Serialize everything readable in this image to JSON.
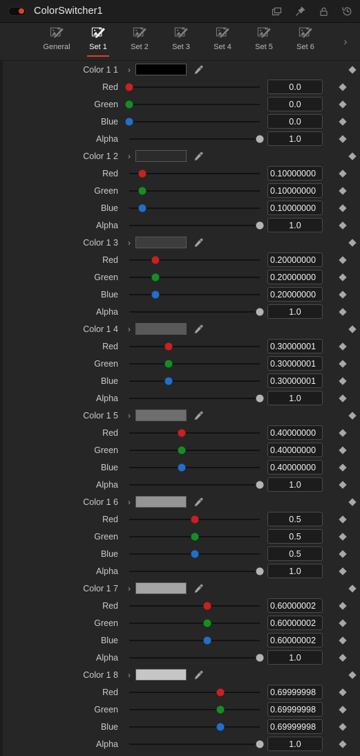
{
  "titlebar": {
    "node_name": "ColorSwitcher1",
    "enabled": true,
    "accent_red": "#e0402b",
    "icons": [
      {
        "name": "duplicate-icon",
        "label": "Duplicate"
      },
      {
        "name": "pin-icon",
        "label": "Pin"
      },
      {
        "name": "unlock-icon",
        "label": "Lock"
      },
      {
        "name": "reset-icon",
        "label": "Reset"
      }
    ]
  },
  "tabs": {
    "active": "Set 1",
    "items": [
      {
        "label": "General",
        "icon": "magic-wand-image-icon"
      },
      {
        "label": "Set 1",
        "icon": "magic-wand-image-icon"
      },
      {
        "label": "Set 2",
        "icon": "magic-wand-image-icon"
      },
      {
        "label": "Set 3",
        "icon": "magic-wand-image-icon"
      },
      {
        "label": "Set 4",
        "icon": "magic-wand-image-icon"
      },
      {
        "label": "Set 5",
        "icon": "magic-wand-image-icon"
      },
      {
        "label": "Set 6",
        "icon": "magic-wand-image-icon"
      }
    ],
    "overflow_label": "›"
  },
  "channel_labels": {
    "red": "Red",
    "green": "Green",
    "blue": "Blue",
    "alpha": "Alpha"
  },
  "expander_glyph": "›",
  "colors": [
    {
      "label": "Color 1 1",
      "swatch": "#000000",
      "red": {
        "value": "0.0",
        "pos": 0.0
      },
      "green": {
        "value": "0.0",
        "pos": 0.0
      },
      "blue": {
        "value": "0.0",
        "pos": 0.0
      },
      "alpha": {
        "value": "1.0",
        "pos": 1.0
      }
    },
    {
      "label": "Color 1 2",
      "swatch": "#2b2b2b",
      "red": {
        "value": "0.10000000",
        "pos": 0.1
      },
      "green": {
        "value": "0.10000000",
        "pos": 0.1
      },
      "blue": {
        "value": "0.10000000",
        "pos": 0.1
      },
      "alpha": {
        "value": "1.0",
        "pos": 1.0
      }
    },
    {
      "label": "Color 1 3",
      "swatch": "#3d3d3d",
      "red": {
        "value": "0.20000000",
        "pos": 0.2
      },
      "green": {
        "value": "0.20000000",
        "pos": 0.2
      },
      "blue": {
        "value": "0.20000000",
        "pos": 0.2
      },
      "alpha": {
        "value": "1.0",
        "pos": 1.0
      }
    },
    {
      "label": "Color 1 4",
      "swatch": "#585858",
      "red": {
        "value": "0.30000001",
        "pos": 0.3
      },
      "green": {
        "value": "0.30000001",
        "pos": 0.3
      },
      "blue": {
        "value": "0.30000001",
        "pos": 0.3
      },
      "alpha": {
        "value": "1.0",
        "pos": 1.0
      }
    },
    {
      "label": "Color 1 5",
      "swatch": "#6e6e6e",
      "red": {
        "value": "0.40000000",
        "pos": 0.4
      },
      "green": {
        "value": "0.40000000",
        "pos": 0.4
      },
      "blue": {
        "value": "0.40000000",
        "pos": 0.4
      },
      "alpha": {
        "value": "1.0",
        "pos": 1.0
      }
    },
    {
      "label": "Color 1 6",
      "swatch": "#949494",
      "red": {
        "value": "0.5",
        "pos": 0.5
      },
      "green": {
        "value": "0.5",
        "pos": 0.5
      },
      "blue": {
        "value": "0.5",
        "pos": 0.5
      },
      "alpha": {
        "value": "1.0",
        "pos": 1.0
      }
    },
    {
      "label": "Color 1 7",
      "swatch": "#a5a5a5",
      "red": {
        "value": "0.60000002",
        "pos": 0.6
      },
      "green": {
        "value": "0.60000002",
        "pos": 0.6
      },
      "blue": {
        "value": "0.60000002",
        "pos": 0.6
      },
      "alpha": {
        "value": "1.0",
        "pos": 1.0
      }
    },
    {
      "label": "Color 1 8",
      "swatch": "#c6c6c6",
      "red": {
        "value": "0.69999998",
        "pos": 0.7
      },
      "green": {
        "value": "0.69999998",
        "pos": 0.7
      },
      "blue": {
        "value": "0.69999998",
        "pos": 0.7
      },
      "alpha": {
        "value": "1.0",
        "pos": 1.0
      }
    }
  ]
}
